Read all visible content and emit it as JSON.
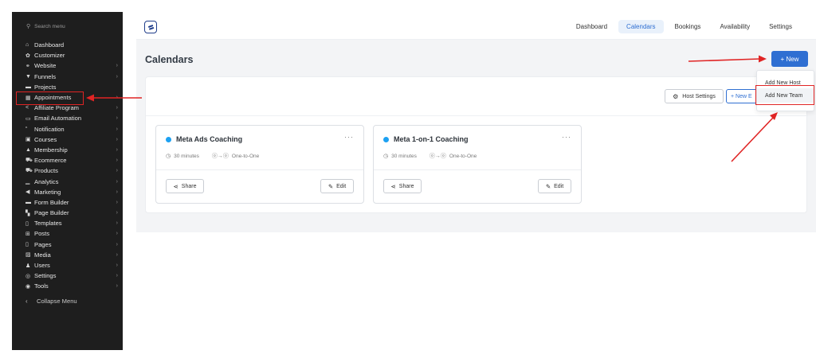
{
  "sidebar": {
    "search_placeholder": "Search menu",
    "items": [
      {
        "label": "Dashboard",
        "icon": "home-icon",
        "glyph": "⌂",
        "chevron": false
      },
      {
        "label": "Customizer",
        "icon": "gear-icon",
        "glyph": "✿",
        "chevron": false
      },
      {
        "label": "Website",
        "icon": "link-icon",
        "glyph": "⚭",
        "chevron": true
      },
      {
        "label": "Funnels",
        "icon": "funnel-icon",
        "glyph": "▼",
        "chevron": true
      },
      {
        "label": "Projects",
        "icon": "folder-icon",
        "glyph": "▬",
        "chevron": false
      },
      {
        "label": "Appointments",
        "icon": "calendar-icon",
        "glyph": "▦",
        "chevron": true
      },
      {
        "label": "Affiliate Program",
        "icon": "share-icon",
        "glyph": "<",
        "chevron": true
      },
      {
        "label": "Email Automation",
        "icon": "mail-icon",
        "glyph": "▭",
        "chevron": true
      },
      {
        "label": "Notification",
        "icon": "quote-icon",
        "glyph": "“",
        "chevron": true
      },
      {
        "label": "Courses",
        "icon": "book-icon",
        "glyph": "▣",
        "chevron": true
      },
      {
        "label": "Membership",
        "icon": "lock-icon",
        "glyph": "▲",
        "chevron": true
      },
      {
        "label": "Ecommerce",
        "icon": "cart-icon",
        "glyph": "⛟",
        "chevron": true
      },
      {
        "label": "Products",
        "icon": "cart-icon",
        "glyph": "⛟",
        "chevron": true
      },
      {
        "label": "Analytics",
        "icon": "chart-icon",
        "glyph": "▁",
        "chevron": true
      },
      {
        "label": "Marketing",
        "icon": "megaphone-icon",
        "glyph": "◀",
        "chevron": true
      },
      {
        "label": "Form Builder",
        "icon": "folder-icon",
        "glyph": "▬",
        "chevron": true
      },
      {
        "label": "Page Builder",
        "icon": "page-icon",
        "glyph": "▚",
        "chevron": true
      },
      {
        "label": "Templates",
        "icon": "document-icon",
        "glyph": "▯",
        "chevron": true
      },
      {
        "label": "Posts",
        "icon": "grid-icon",
        "glyph": "⊞",
        "chevron": true
      },
      {
        "label": "Pages",
        "icon": "document-icon",
        "glyph": "▯",
        "chevron": true
      },
      {
        "label": "Media",
        "icon": "image-icon",
        "glyph": "▨",
        "chevron": true
      },
      {
        "label": "Users",
        "icon": "users-icon",
        "glyph": "♟",
        "chevron": true
      },
      {
        "label": "Settings",
        "icon": "settings-icon",
        "glyph": "◎",
        "chevron": true
      },
      {
        "label": "Tools",
        "icon": "tools-icon",
        "glyph": "◉",
        "chevron": true
      }
    ],
    "collapse_label": "Collapse Menu"
  },
  "topnav": {
    "tabs": [
      {
        "label": "Dashboard",
        "active": false
      },
      {
        "label": "Calendars",
        "active": true
      },
      {
        "label": "Bookings",
        "active": false
      },
      {
        "label": "Availability",
        "active": false
      },
      {
        "label": "Settings",
        "active": false
      }
    ]
  },
  "page": {
    "title": "Calendars",
    "new_button": "+ New",
    "host_settings": "Host Settings",
    "new_calendar_partial": "+ New E"
  },
  "dropdown": {
    "items": [
      "Add New Host",
      "Add New Team"
    ]
  },
  "cards": [
    {
      "name": "Meta Ads Coaching",
      "duration": "30 minutes",
      "type": "One-to-One",
      "share": "Share",
      "edit": "Edit",
      "more": "···"
    },
    {
      "name": "Meta 1-on-1 Coaching",
      "duration": "30 minutes",
      "type": "One-to-One",
      "share": "Share",
      "edit": "Edit",
      "more": "···"
    }
  ],
  "colors": {
    "accent": "#2f6fd2",
    "annotation": "#e02424",
    "sidebar_bg": "#1e1e1e",
    "status_dot": "#1da1f2"
  }
}
